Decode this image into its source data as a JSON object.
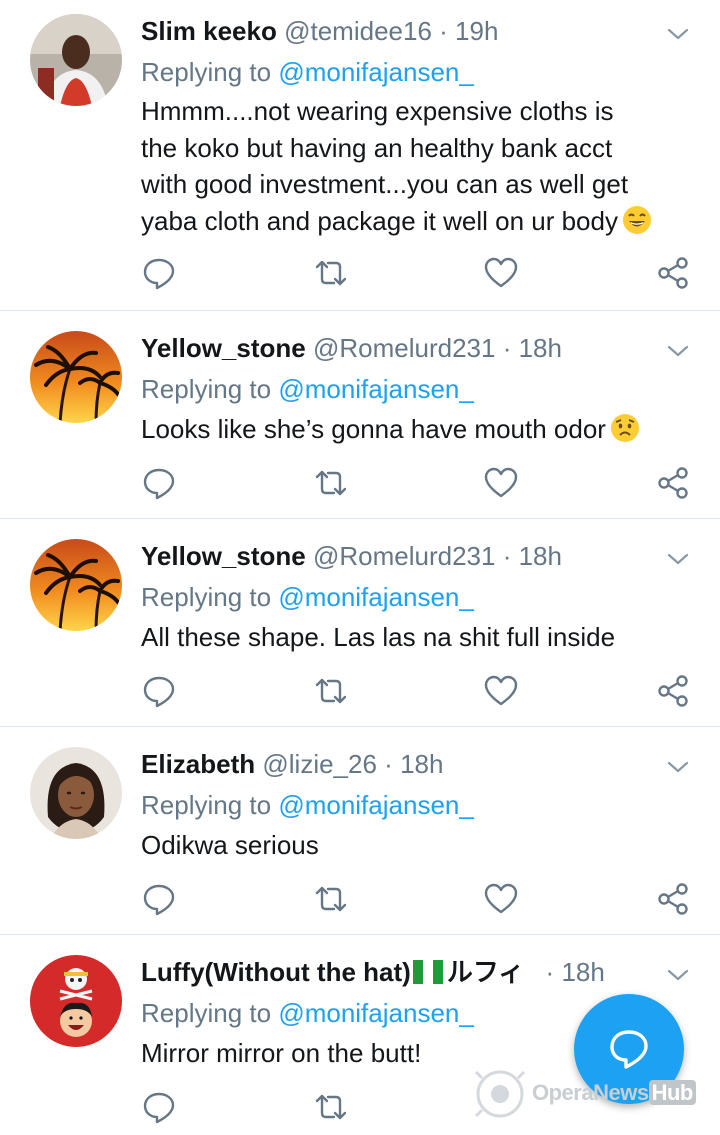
{
  "tweets": [
    {
      "name": "Slim keeko",
      "handle": "@temidee16",
      "dot": "·",
      "time": "19h",
      "replying_prefix": "Replying to",
      "replying_to": "@monifajansen_",
      "lines": [
        "Hmmm....not wearing expensive cloths is",
        "the koko but having an healthy bank acct",
        "with good investment...you can as well get",
        "yaba cloth and package it well on ur body"
      ],
      "emoji": "grinning-face-emoji",
      "avatar": "man-photo-avatar"
    },
    {
      "name": "Yellow_stone",
      "handle": "@Romelurd231",
      "dot": "·",
      "time": "18h",
      "replying_prefix": "Replying to",
      "replying_to": "@monifajansen_",
      "lines": [
        "Looks like she’s gonna have mouth odor"
      ],
      "emoji": "worried-face-emoji",
      "avatar": "palm-sunset-avatar"
    },
    {
      "name": "Yellow_stone",
      "handle": "@Romelurd231",
      "dot": "·",
      "time": "18h",
      "replying_prefix": "Replying to",
      "replying_to": "@monifajansen_",
      "lines": [
        "All these shape. Las las na shit full inside"
      ],
      "avatar": "palm-sunset-avatar"
    },
    {
      "name": "Elizabeth",
      "handle": "@lizie_26",
      "dot": "·",
      "time": "18h",
      "replying_prefix": "Replying to",
      "replying_to": "@monifajansen_",
      "lines": [
        "Odikwa serious"
      ],
      "avatar": "woman-photo-avatar"
    },
    {
      "name": "Luffy(Without the hat)",
      "handle": "ルフィ",
      "dot": "·",
      "time": "18h",
      "replying_prefix": "Replying to",
      "replying_to": "@monifajansen_",
      "lines": [
        "Mirror mirror on the butt!"
      ],
      "flag": "nigeria-flag-emoji",
      "avatar": "one-piece-luffy-avatar"
    }
  ],
  "watermark": {
    "brand": "OperaNews",
    "suffix": "Hub"
  },
  "colors": {
    "accent": "#1da1f2",
    "muted": "#657786",
    "text": "#14171a",
    "divider": "#e1e8ed"
  }
}
